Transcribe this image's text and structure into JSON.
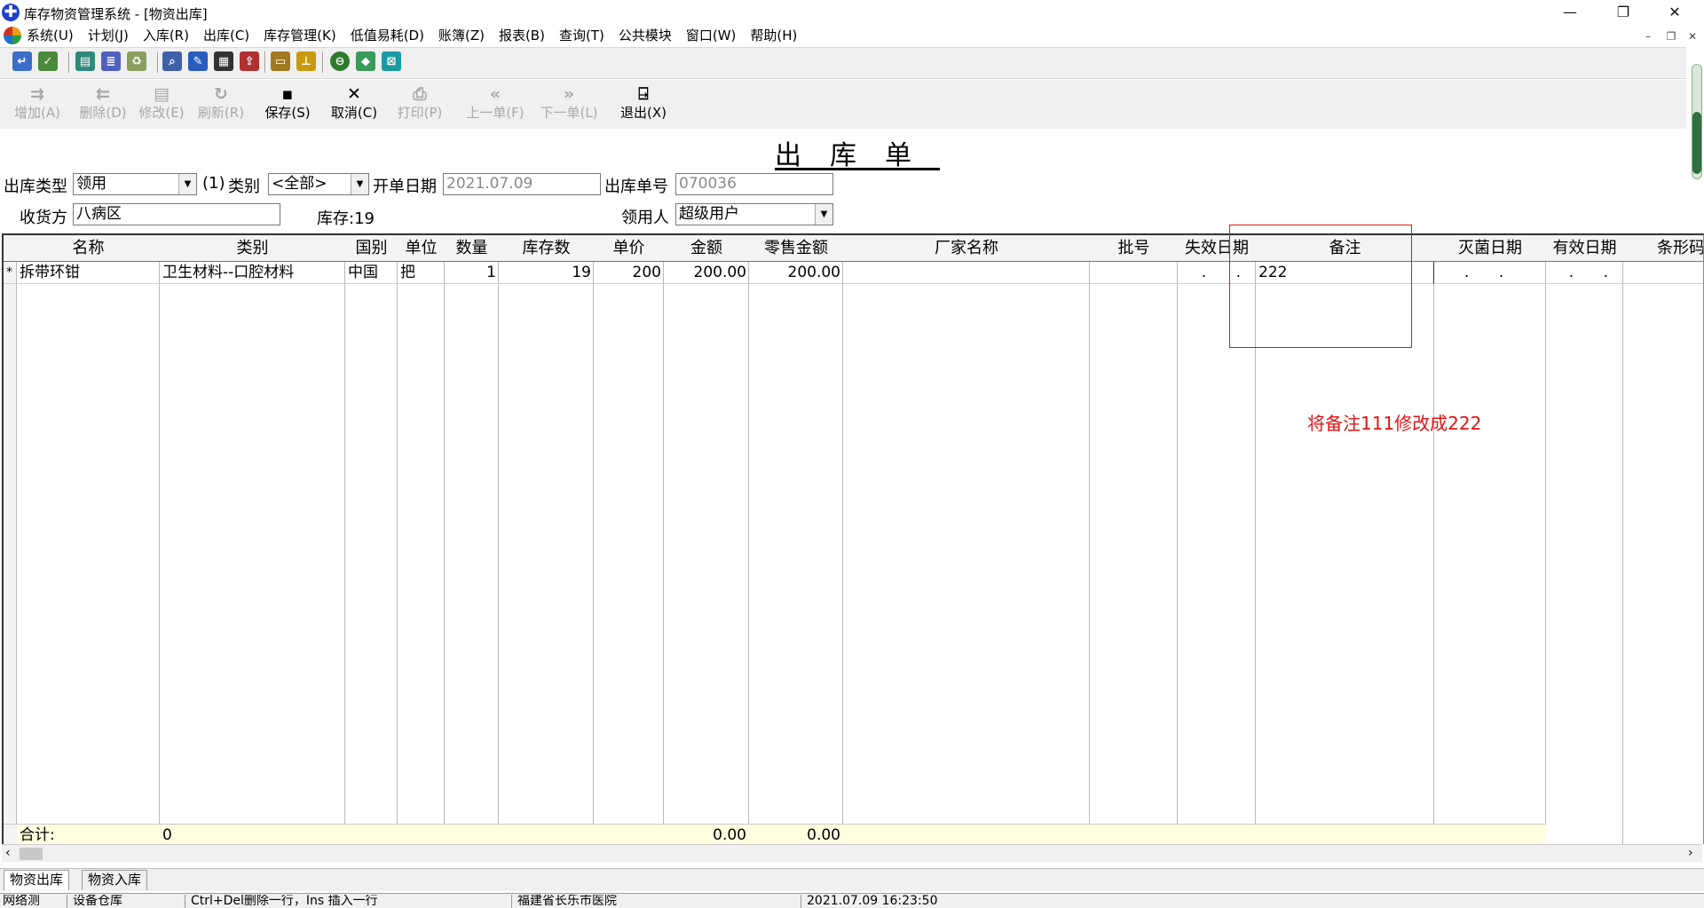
{
  "window": {
    "title": "库存物资管理系统 - [物资出库]",
    "controls": [
      "—",
      "❐",
      "✕"
    ]
  },
  "menu": [
    "系统(U)",
    "计划(J)",
    "入库(R)",
    "出库(C)",
    "库存管理(K)",
    "低值易耗(D)",
    "账簿(Z)",
    "报表(B)",
    "查询(T)",
    "公共模块",
    "窗口(W)",
    "帮助(H)"
  ],
  "toolbar": {
    "add": "增加(A)",
    "delete": "删除(D)",
    "edit": "修改(E)",
    "refresh": "刷新(R)",
    "save": "保存(S)",
    "cancel": "取消(C)",
    "print": "打印(P)",
    "prev": "上一单(F)",
    "next": "下一单(L)",
    "exit": "退出(X)"
  },
  "form": {
    "title": "出库单",
    "out_type_label": "出库类型",
    "out_type_value": "领用",
    "hint": "(1)",
    "category_label": "类别",
    "category_value": "<全部>",
    "date_label": "开单日期",
    "date_value": "2021.07.09",
    "no_label": "出库单号",
    "no_value": "070036",
    "receiver_label": "收货方",
    "receiver_value": "八病区",
    "stock_text": "库存:19",
    "user_label": "领用人",
    "user_value": "超级用户"
  },
  "grid": {
    "columns": [
      "名称",
      "类别",
      "国别",
      "单位",
      "数量",
      "库存数",
      "单价",
      "金额",
      "零售金额",
      "厂家名称",
      "批号",
      "失效日期",
      "备注",
      "灭菌日期",
      "有效日期",
      "条形码"
    ],
    "row": {
      "marker": "*",
      "name": "拆带环钳",
      "category": "卫生材料--口腔材料",
      "country": "中国",
      "unit": "把",
      "qty": "1",
      "stock": "19",
      "price": "200",
      "amount": "200.00",
      "retail": "200.00",
      "vendor": "",
      "batch": "",
      "expire": ". .",
      "note": "222",
      "sterile": ". .",
      "valid": ". .",
      "barcode": ""
    },
    "total": {
      "label": "合计:",
      "category": "0",
      "amount": "0.00",
      "retail": "0.00"
    }
  },
  "annotation": "将备注111修改成222",
  "tabs": [
    "物资出库",
    "物资入库"
  ],
  "status": [
    "网络测",
    "设备仓库",
    "Ctrl+Del删除一行，Ins 插入一行",
    "福建省长乐市医院",
    "2021.07.09 16:23:50"
  ],
  "colors": {
    "annotation": "#e01414",
    "total_row": "#ffffe0"
  }
}
